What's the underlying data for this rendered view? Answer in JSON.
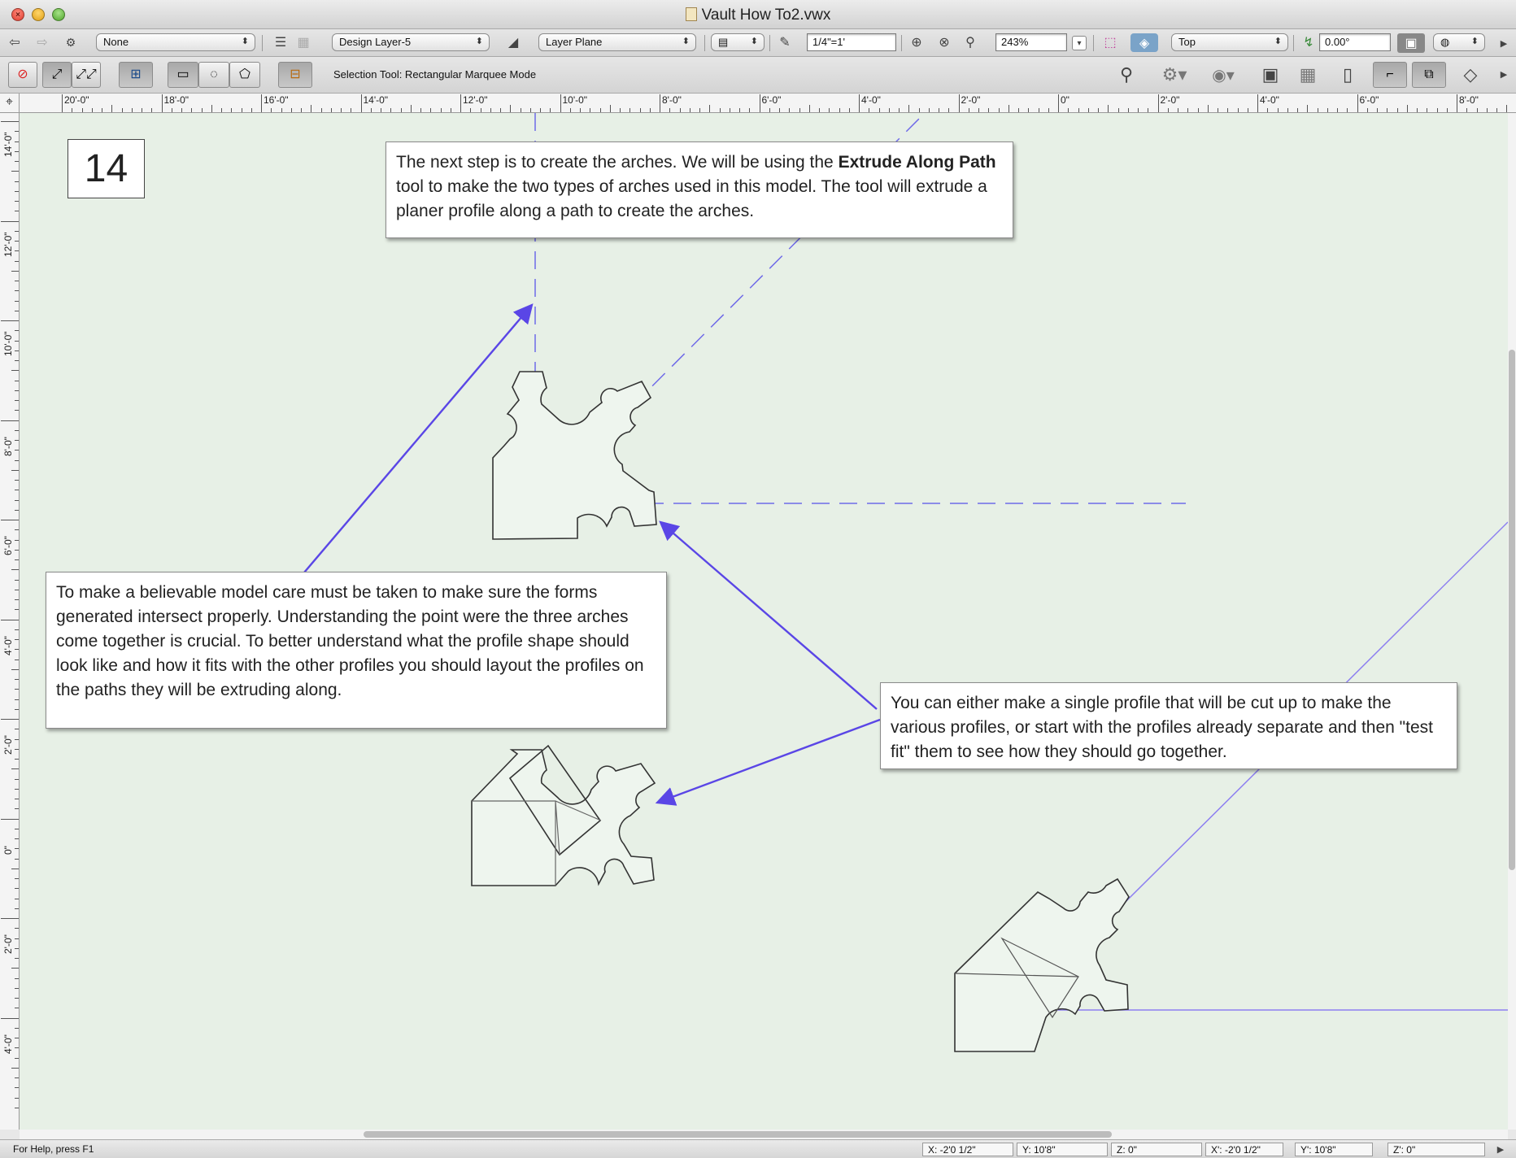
{
  "window": {
    "title": "Vault How To2.vwx",
    "close": "×"
  },
  "toolbar1": {
    "class_select": "None",
    "layer_select": "Design Layer-5",
    "plane_select": "Layer Plane",
    "scale_field": "1/4\"=1'",
    "zoom_field": "243%",
    "view_select": "Top",
    "rotation_field": "0.00°"
  },
  "toolbar2": {
    "mode_text": "Selection Tool: Rectangular Marquee Mode"
  },
  "ruler": {
    "top_labels": [
      "20'-0\"",
      "18'-0\"",
      "16'-0\"",
      "14'-0\"",
      "12'-0\"",
      "10'-0\"",
      "8'-0\"",
      "6'-0\"",
      "4'-0\"",
      "2'-0\"",
      "0\"",
      "2'-0\"",
      "4'-0\"",
      "6'-0\"",
      "8'-0\""
    ],
    "left_labels": [
      "14'-0\"",
      "12'-0\"",
      "10'-0\"",
      "8'-0\"",
      "6'-0\"",
      "4'-0\"",
      "2'-0\"",
      "0\"",
      "2'-0\"",
      "4'-0\""
    ]
  },
  "canvas": {
    "step_number": "14",
    "callout_top_pre": "The next step is to create the arches. We will be using the ",
    "callout_top_bold": "Extrude Along Path",
    "callout_top_post": " tool to make the two types of arches used in this model. The tool will extrude a planer profile along a path to create the arches.",
    "callout_left": "To make a believable model care must be taken to make sure the forms generated intersect properly. Understanding the point were the three arches come together is crucial. To better understand what the profile shape should look like and how it fits with the other profiles you should layout the profiles on the paths they will be extruding along.",
    "callout_right": "You can either make a single profile that will be cut up to make the various profiles, or start with the profiles already separate and then \"test fit\" them to see how they should go together."
  },
  "status": {
    "help": "For Help, press F1",
    "x": "X:  -2'0 1/2\"",
    "y": "Y:  10'8\"",
    "z": "Z:  0\"",
    "x2": "X':  -2'0 1/2\"",
    "y2": "Y':  10'8\"",
    "z2": "Z':  0\""
  },
  "colors": {
    "canvas": "#e7f0e6",
    "arrow": "#5a46e6",
    "guide": "#6f6ae8"
  }
}
